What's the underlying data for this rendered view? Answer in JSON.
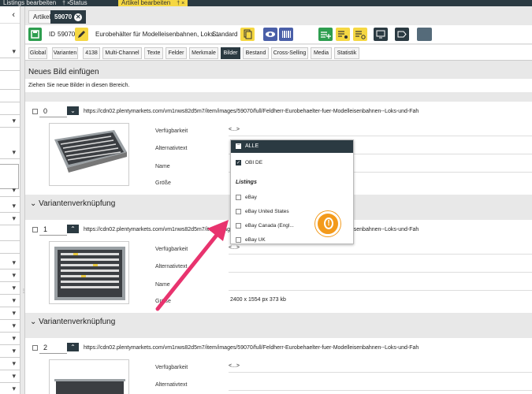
{
  "topbar": {
    "tabs": [
      {
        "label": "Listings bearbeiten",
        "pin": "†  ×"
      },
      {
        "label": "Status",
        "pin": ""
      },
      {
        "label": "Artikel bearbeiten",
        "pin": "†  ×"
      }
    ]
  },
  "left_panel": {
    "collapse_glyph": "‹",
    "row_glyph": "▾"
  },
  "editor_tabs": {
    "artikel": "Artikel",
    "item": "59070",
    "close": "✕"
  },
  "toolbar": {
    "id_label": "ID",
    "id_value": "59070",
    "item_name": "Eurobehälter für Modelleisenbahnen, Loks...",
    "view_select": "Standard"
  },
  "subtabs": [
    "Global",
    "Varianten",
    "4138",
    "Multi-Channel",
    "Texte",
    "Felder",
    "Merkmale",
    "Bilder",
    "Bestand",
    "Cross-Selling",
    "Media",
    "Statistik"
  ],
  "active_subtab": "Bilder",
  "new_image": {
    "title": "Neues Bild einfügen",
    "dropzone": "Ziehen Sie neue Bilder in diesen Bereich."
  },
  "field_labels": {
    "availability": "Verfügbarkeit",
    "alt_text": "Alternativtext",
    "name": "Name",
    "size": "Größe"
  },
  "images": [
    {
      "position": "0",
      "url": "https://cdn02.plentymarkets.com/vm1nws82d5m7/item/images/59070/full/Feldherr-Eurobehaelter-fuer-Modelleisenbahnen--Loks-und-Fah",
      "availability": "<...>",
      "size": "",
      "expanded": false
    },
    {
      "position": "1",
      "url": "https://cdn02.plentymarkets.com/vm1nws82d5m7/item/images/59070/full/Feldherr-Eurobehaelter-fuer-Modelleisenbahnen--Loks-und-Fah",
      "availability": "<...>",
      "size": "2400 x 1554 px   373 kb",
      "expanded": true
    },
    {
      "position": "2",
      "url": "https://cdn02.plentymarkets.com/vm1nws82d5m7/item/images/59070/full/Feldherr-Eurobehaelter-fuer-Modelleisenbahnen--Loks-und-Fah",
      "availability": "<...>",
      "size": "",
      "expanded": true
    }
  ],
  "variant_link": "Variantenverknüpfung",
  "variant_link_chevron": "⌄",
  "collapse_chevron_down": "⌄",
  "collapse_chevron_up": "⌃",
  "dropdown": {
    "header": "ALLE",
    "header_glyph": "−",
    "check_glyph": "✓",
    "options_top": [
      {
        "label": "OBI DE",
        "checked": true
      }
    ],
    "group": "Listings",
    "options": [
      {
        "label": "eBay",
        "checked": false
      },
      {
        "label": "eBay United States",
        "checked": false
      },
      {
        "label": "eBay Canada (Engl...",
        "checked": false
      },
      {
        "label": "eBay UK",
        "checked": false
      }
    ]
  },
  "warning_glyph": "!",
  "colors": {
    "accent": "#2b3a42",
    "highlight": "#f5d742",
    "warning": "#f39a1b",
    "arrow": "#e8336e"
  }
}
